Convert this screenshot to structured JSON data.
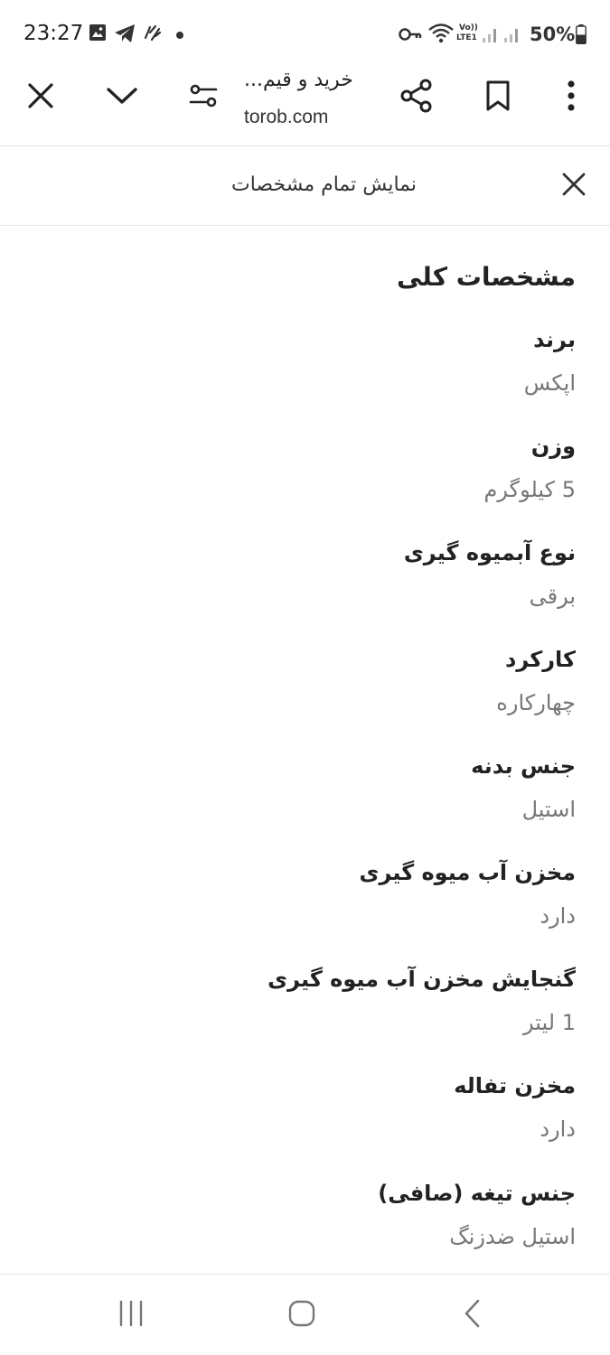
{
  "status_bar": {
    "time": "23:27",
    "battery": "50%",
    "icons": [
      "image-icon",
      "telegram-icon",
      "app-icon",
      "key-icon",
      "wifi-icon",
      "volte-icon",
      "signal-icon",
      "battery-icon"
    ],
    "volte_label": "Vo))",
    "lte_label": "LTE1"
  },
  "toolbar": {
    "title": "خرید و قیم...",
    "url": "torob.com",
    "icons": [
      "close-icon",
      "chevron-down-icon",
      "page-settings-icon",
      "share-icon",
      "bookmark-icon",
      "more-vert-icon"
    ]
  },
  "sheet": {
    "title": "نمایش تمام مشخصات"
  },
  "section": {
    "title": "مشخصات کلی"
  },
  "specs": [
    {
      "label": "برند",
      "value": "اپکس"
    },
    {
      "label": "وزن",
      "value": "5 کیلوگرم"
    },
    {
      "label": "نوع آبمیوه گیری",
      "value": "برقی"
    },
    {
      "label": "کارکرد",
      "value": "چهارکاره"
    },
    {
      "label": "جنس بدنه",
      "value": "استیل"
    },
    {
      "label": "مخزن آب میوه گیری",
      "value": "دارد"
    },
    {
      "label": "گنجایش مخزن آب میوه گیری",
      "value": "1 لیتر"
    },
    {
      "label": "مخزن تفاله",
      "value": "دارد"
    },
    {
      "label": "جنس تیغه (صافی)",
      "value": "استیل ضدزنگ"
    }
  ],
  "nav_bar": {
    "icons": [
      "recents-icon",
      "home-icon",
      "back-icon"
    ]
  }
}
